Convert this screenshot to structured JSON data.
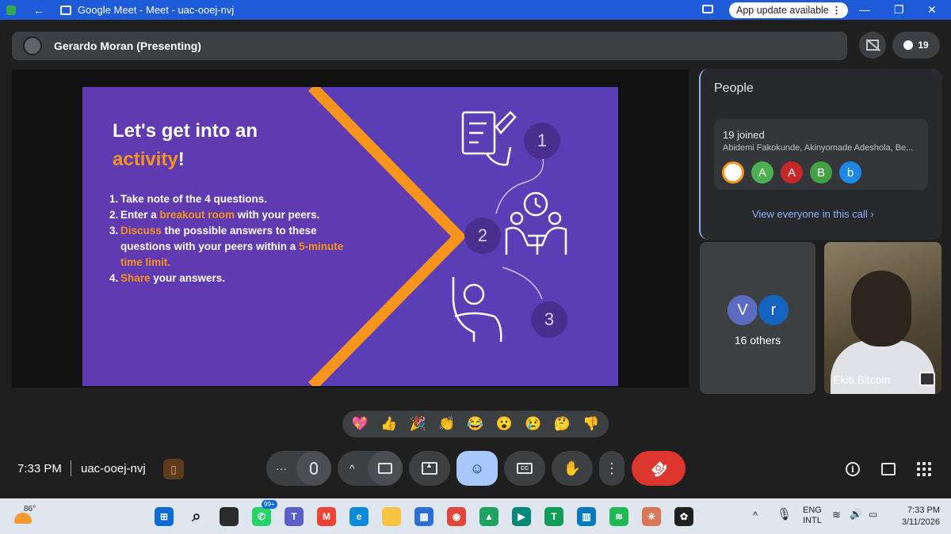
{
  "window": {
    "title": "Google Meet - Meet - uac-ooej-nvj",
    "update_label": "App update available",
    "update_menu": "⋮",
    "back": "←",
    "minimize": "—",
    "maximize": "❐",
    "close": "✕"
  },
  "presenter": {
    "name": "Gerardo Moran (Presenting)"
  },
  "participants_count": "19",
  "slide": {
    "title_line1": "Let's get into an",
    "title_highlight": "activity",
    "title_exclaim": "!",
    "items": [
      {
        "num": "1.",
        "parts": [
          {
            "t": "Take note of the 4 questions.",
            "o": false
          }
        ]
      },
      {
        "num": "2.",
        "parts": [
          {
            "t": "Enter a ",
            "o": false
          },
          {
            "t": "breakout room",
            "o": true
          },
          {
            "t": " with your peers.",
            "o": false
          }
        ]
      },
      {
        "num": "3.",
        "parts": [
          {
            "t": "Discuss",
            "o": true
          },
          {
            "t": " the possible answers to these questions with your peers within a ",
            "o": false
          },
          {
            "t": "5-minute time limit.",
            "o": true
          }
        ]
      },
      {
        "num": "4.",
        "parts": [
          {
            "t": "Share",
            "o": true
          },
          {
            "t": " your answers.",
            "o": false
          }
        ]
      }
    ],
    "steps": [
      "1",
      "2",
      "3"
    ]
  },
  "people_panel": {
    "title": "People",
    "joined": "19 joined",
    "names": "Abidemi Fakokunde, Akinyomade Adeshola, Be...",
    "avatars": [
      {
        "letter": "",
        "color": "#ffffff"
      },
      {
        "letter": "A",
        "color": "#4caf50"
      },
      {
        "letter": "A",
        "color": "#c62828"
      },
      {
        "letter": "B",
        "color": "#43a047"
      },
      {
        "letter": "b",
        "color": "#1e88e5"
      },
      {
        "letter": "",
        "color": "#35363a"
      }
    ],
    "view_all": "View everyone in this call"
  },
  "tiles": {
    "others_letters": [
      "V",
      "r"
    ],
    "others_label": "16 others",
    "camera_name": "Ekiti Bitcoin"
  },
  "reactions": [
    "💖",
    "👍",
    "🎉",
    "👏",
    "😂",
    "😮",
    "😢",
    "🤔",
    "👎"
  ],
  "meeting": {
    "time": "7:33 PM",
    "code": "uac-ooej-nvj"
  },
  "controls": {
    "more_options": "···",
    "chevron_up": "^",
    "more_vert": "⋮",
    "end_call": "☎"
  },
  "taskbar": {
    "weather_temp": "86°",
    "badge": "99+",
    "lang_line1": "ENG",
    "lang_line2": "INTL",
    "clock_time": "7:33 PM",
    "clock_date": "3/11/2026",
    "apps": [
      {
        "name": "start-icon",
        "color": "#0a6cd4",
        "glyph": "⊞"
      },
      {
        "name": "search-icon",
        "color": "transparent",
        "glyph": "⌕"
      },
      {
        "name": "task-view-icon",
        "color": "#2b2b2b",
        "glyph": ""
      },
      {
        "name": "whatsapp-icon",
        "color": "#25d366",
        "glyph": "✆"
      },
      {
        "name": "teams-icon",
        "color": "#5b5fc7",
        "glyph": "T"
      },
      {
        "name": "gmail-icon",
        "color": "#ea4335",
        "glyph": "M"
      },
      {
        "name": "edge-icon",
        "color": "#0c8ad8",
        "glyph": "e"
      },
      {
        "name": "file-explorer-icon",
        "color": "#f6c343",
        "glyph": ""
      },
      {
        "name": "store-icon",
        "color": "#2b6fd6",
        "glyph": "▦"
      },
      {
        "name": "chrome-icon",
        "color": "#e0463b",
        "glyph": "◉"
      },
      {
        "name": "drive-icon",
        "color": "#1ea362",
        "glyph": "▲"
      },
      {
        "name": "meet-icon",
        "color": "#00897b",
        "glyph": "▶"
      },
      {
        "name": "sheets-icon",
        "color": "#0f9d58",
        "glyph": "T"
      },
      {
        "name": "trello-icon",
        "color": "#0079bf",
        "glyph": "▥"
      },
      {
        "name": "spotify-icon",
        "color": "#1db954",
        "glyph": "≋"
      },
      {
        "name": "claude-icon",
        "color": "#d97757",
        "glyph": "✳"
      },
      {
        "name": "chatgpt-icon",
        "color": "#1f1f1f",
        "glyph": "✿"
      }
    ]
  }
}
